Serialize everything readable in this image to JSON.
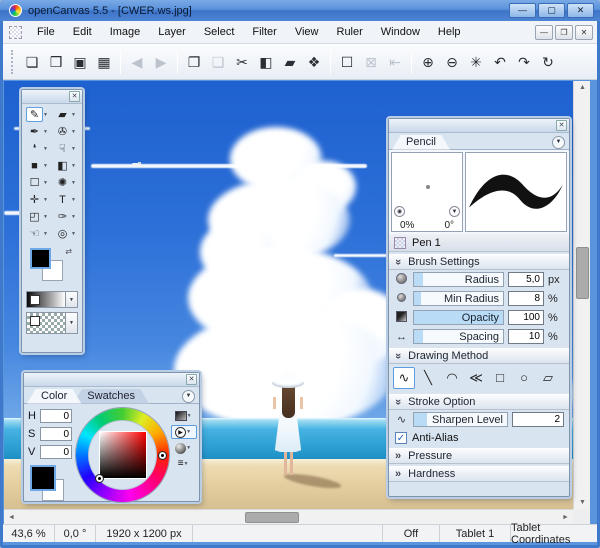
{
  "window": {
    "title": "openCanvas 5.5 - [CWER.ws.jpg]"
  },
  "menu": [
    "File",
    "Edit",
    "Image",
    "Layer",
    "Select",
    "Filter",
    "View",
    "Ruler",
    "Window",
    "Help"
  ],
  "toolbar": [
    {
      "name": "new",
      "glyph": "❏"
    },
    {
      "name": "open",
      "glyph": "❒"
    },
    {
      "name": "save",
      "glyph": "▣"
    },
    {
      "name": "save-as",
      "glyph": "▦"
    },
    {
      "name": "nav-back",
      "glyph": "◀"
    },
    {
      "name": "nav-forward",
      "glyph": "▶"
    },
    {
      "name": "copy",
      "glyph": "❐"
    },
    {
      "name": "paste",
      "glyph": "❑"
    },
    {
      "name": "cut",
      "glyph": "✂"
    },
    {
      "name": "fill",
      "glyph": "◧"
    },
    {
      "name": "eraser",
      "glyph": "▰"
    },
    {
      "name": "transform",
      "glyph": "❖"
    },
    {
      "name": "select-rectangle",
      "glyph": "☐"
    },
    {
      "name": "deselect",
      "glyph": "⊠"
    },
    {
      "name": "paste-into-selection",
      "glyph": "⇤"
    },
    {
      "name": "zoom-in",
      "glyph": "⊕"
    },
    {
      "name": "zoom-out",
      "glyph": "⊖"
    },
    {
      "name": "zoom-actual",
      "glyph": "✳"
    },
    {
      "name": "undo",
      "glyph": "↶"
    },
    {
      "name": "redo",
      "glyph": "↷"
    },
    {
      "name": "redo-history",
      "glyph": "↻"
    }
  ],
  "tools": [
    {
      "name": "pencil",
      "glyph": "✎"
    },
    {
      "name": "eraser",
      "glyph": "▰"
    },
    {
      "name": "pen",
      "glyph": "✒"
    },
    {
      "name": "airbrush",
      "glyph": "✇"
    },
    {
      "name": "watercolor",
      "glyph": "❛"
    },
    {
      "name": "finger",
      "glyph": "☟"
    },
    {
      "name": "shape-fill",
      "glyph": "■"
    },
    {
      "name": "bucket-fill",
      "glyph": "◧"
    },
    {
      "name": "marquee",
      "glyph": "☐"
    },
    {
      "name": "magic-wand",
      "glyph": "✺"
    },
    {
      "name": "move",
      "glyph": "✛"
    },
    {
      "name": "text",
      "glyph": "T"
    },
    {
      "name": "crop",
      "glyph": "◰"
    },
    {
      "name": "eyedropper",
      "glyph": "✑"
    },
    {
      "name": "hand",
      "glyph": "☜"
    },
    {
      "name": "zoom",
      "glyph": "◎"
    }
  ],
  "color_panel": {
    "tabs": [
      "Color",
      "Swatches"
    ],
    "hsv": [
      {
        "label": "H",
        "value": "0"
      },
      {
        "label": "S",
        "value": "0"
      },
      {
        "label": "V",
        "value": "0"
      }
    ]
  },
  "brush_panel": {
    "tab": "Pencil",
    "preview_percent": "0%",
    "preview_angle": "0°",
    "pen_name": "Pen 1",
    "brush_settings_title": "Brush Settings",
    "sliders": [
      {
        "label": "Radius",
        "value": "5,0",
        "unit": "px",
        "fill": 10
      },
      {
        "label": "Min Radius",
        "value": "8",
        "unit": "%",
        "fill": 8
      },
      {
        "label": "Opacity",
        "value": "100",
        "unit": "%",
        "fill": 100
      },
      {
        "label": "Spacing",
        "value": "10",
        "unit": "%",
        "fill": 10
      }
    ],
    "drawing_method_title": "Drawing Method",
    "shapes": [
      {
        "name": "freehand",
        "glyph": "∿"
      },
      {
        "name": "line",
        "glyph": "╲"
      },
      {
        "name": "curve",
        "glyph": "◠"
      },
      {
        "name": "polyline",
        "glyph": "≪"
      },
      {
        "name": "rectangle",
        "glyph": "□"
      },
      {
        "name": "ellipse",
        "glyph": "○"
      },
      {
        "name": "polygon",
        "glyph": "▱"
      }
    ],
    "stroke_option_title": "Stroke Option",
    "sharpen": {
      "label": "Sharpen Level",
      "value": "2",
      "fill": 14
    },
    "anti_alias_label": "Anti-Alias",
    "pressure_title": "Pressure",
    "hardness_title": "Hardness"
  },
  "status": {
    "zoom": "43,6 %",
    "rotation": "0,0 °",
    "canvas_size": "1920 x 1200 px",
    "tablet_pressure": "Off",
    "tablet_device": "Tablet 1",
    "tablet_mode": "Tablet Coordinates"
  },
  "glyphs": {
    "minimize": "—",
    "maximize": "▢",
    "restore": "❐",
    "close": "✕",
    "panel_close": "✕",
    "dropdown": "▼",
    "chevron": "»",
    "check": "✓",
    "swap": "⇄",
    "scroll_up": "▲",
    "scroll_down": "▼",
    "scroll_left": "◄",
    "scroll_right": "►",
    "spacing_arrow": "↔",
    "wave": "∿",
    "target": "◉",
    "play": "▶",
    "menu_lines": "≡"
  },
  "colors": {
    "titlebar_blue": "#4d84d4",
    "selection_blue": "#6ea8e6",
    "sky_top": "#1e61d0",
    "ocean": "#2d9fd2",
    "sand": "#e2cb9c"
  }
}
